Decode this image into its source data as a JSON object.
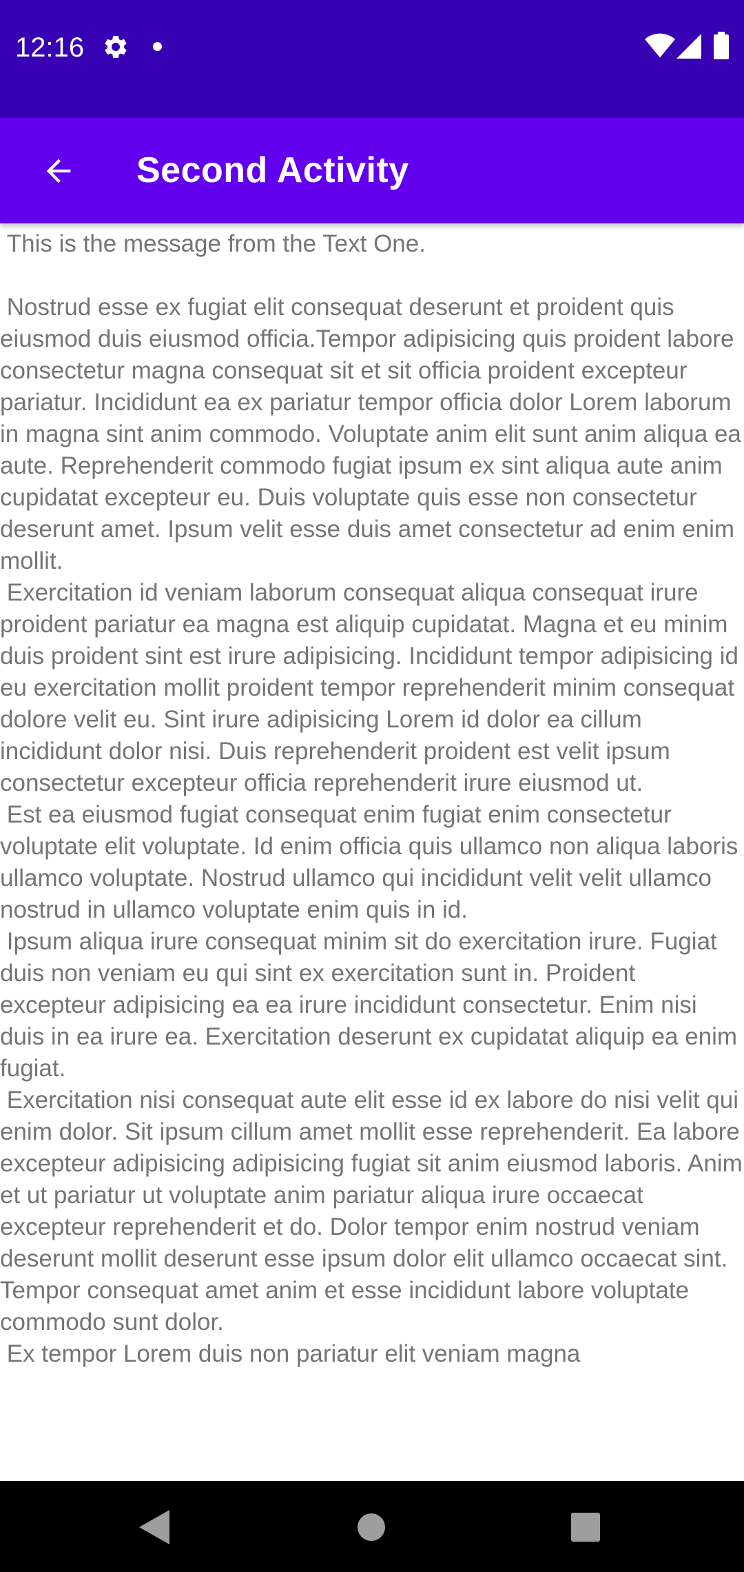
{
  "status_bar": {
    "time": "12:16",
    "icons": [
      "gear-icon",
      "notification-dot-icon",
      "wifi-icon",
      "signal-icon",
      "battery-icon"
    ]
  },
  "app_bar": {
    "title": "Second Activity",
    "back_icon": "arrow-left-icon"
  },
  "content": {
    "message": " This is the message from the Text One.\n\n Nostrud esse ex fugiat elit consequat deserunt et proident quis eiusmod duis eiusmod officia.Tempor adipisicing quis proident labore consectetur magna consequat sit et sit officia proident excepteur pariatur. Incididunt ea ex pariatur tempor officia dolor Lorem laborum in magna sint anim commodo. Voluptate anim elit sunt anim aliqua ea aute. Reprehenderit commodo fugiat ipsum ex sint aliqua aute anim cupidatat excepteur eu. Duis voluptate quis esse non consectetur deserunt amet. Ipsum velit esse duis amet consectetur ad enim enim mollit.\n Exercitation id veniam laborum consequat aliqua consequat irure proident pariatur ea magna est aliquip cupidatat. Magna et eu minim duis proident sint est irure adipisicing. Incididunt tempor adipisicing id eu exercitation mollit proident tempor reprehenderit minim consequat dolore velit eu. Sint irure adipisicing Lorem id dolor ea cillum incididunt dolor nisi. Duis reprehenderit proident est velit ipsum consectetur excepteur officia reprehenderit irure eiusmod ut.\n Est ea eiusmod fugiat consequat enim fugiat enim consectetur voluptate elit voluptate. Id enim officia quis ullamco non aliqua laboris ullamco voluptate. Nostrud ullamco qui incididunt velit velit ullamco nostrud in ullamco voluptate enim quis in id.\n Ipsum aliqua irure consequat minim sit do exercitation irure. Fugiat duis non veniam eu qui sint ex exercitation sunt in. Proident excepteur adipisicing ea ea irure incididunt consectetur. Enim nisi duis in ea irure ea. Exercitation deserunt ex cupidatat aliquip ea enim fugiat.\n Exercitation nisi consequat aute elit esse id ex labore do nisi velit qui enim dolor. Sit ipsum cillum amet mollit esse reprehenderit. Ea labore excepteur adipisicing adipisicing fugiat sit anim eiusmod laboris. Anim et ut pariatur ut voluptate anim pariatur aliqua irure occaecat excepteur reprehenderit et do. Dolor tempor enim nostrud veniam deserunt mollit deserunt esse ipsum dolor elit ullamco occaecat sint. Tempor consequat amet anim et esse incididunt labore voluptate commodo sunt dolor.\n Ex tempor Lorem duis non pariatur elit veniam magna"
  },
  "nav_bar": {
    "icons": [
      "nav-back-icon",
      "nav-home-icon",
      "nav-recents-icon"
    ]
  },
  "colors": {
    "status_bar": "#3700B3",
    "app_bar": "#6200EE",
    "body_text": "#757575",
    "nav_bar": "#000000"
  }
}
